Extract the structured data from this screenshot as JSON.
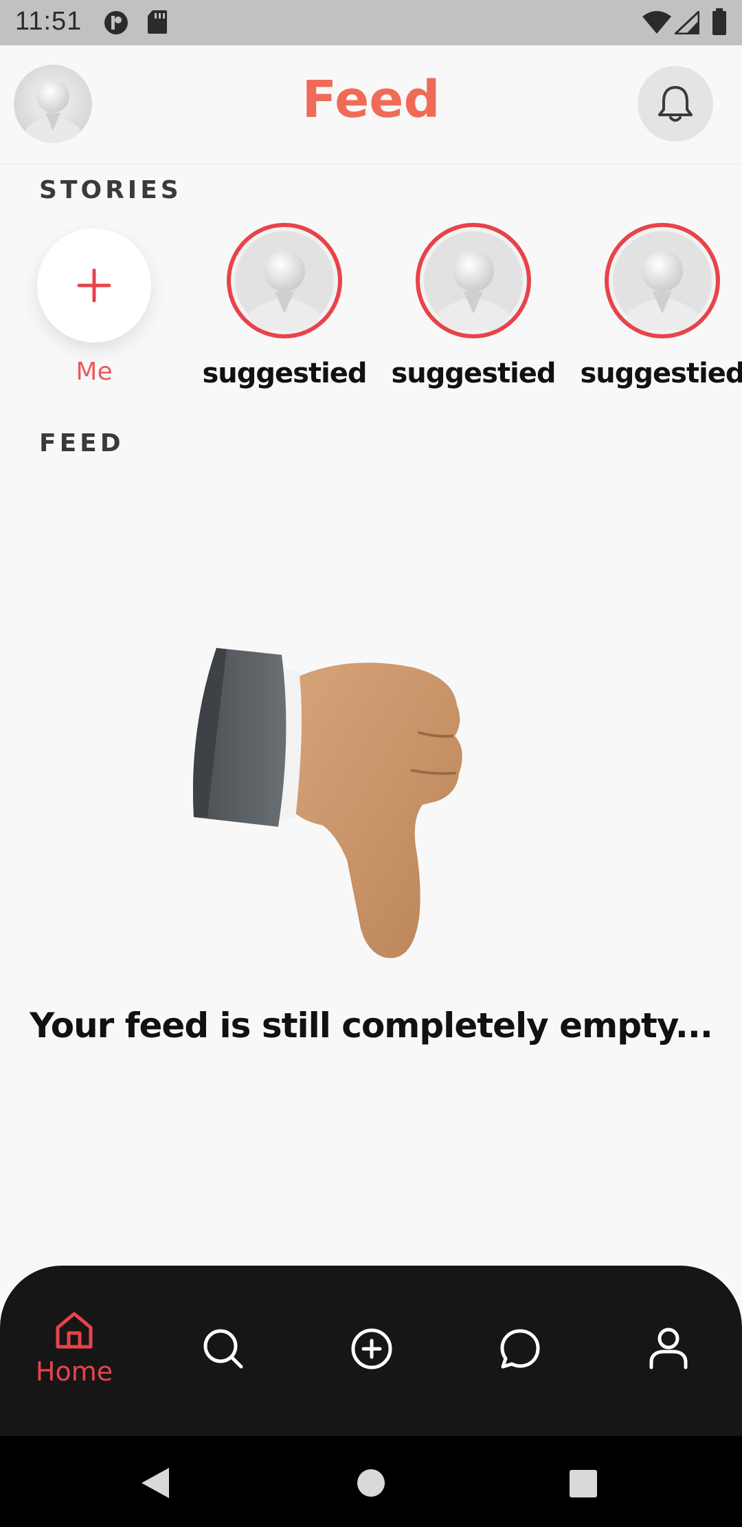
{
  "status_bar": {
    "time": "11:51",
    "left_icons": [
      "p-notification-icon",
      "sd-card-icon"
    ],
    "right_icons": [
      "wifi-icon",
      "cell-signal-icon",
      "battery-icon"
    ]
  },
  "header": {
    "title": "Feed",
    "title_color": "#ef6b57",
    "avatar_icon": "avatar-figure",
    "notification_icon": "bell-icon"
  },
  "stories": {
    "section_label": "STORIES",
    "add_story": {
      "label": "Me",
      "icon": "plus-icon"
    },
    "items": [
      {
        "label": "suggestied"
      },
      {
        "label": "suggestied"
      },
      {
        "label": "suggestied"
      }
    ],
    "ring_color": "#e8434a"
  },
  "feed": {
    "section_label": "FEED",
    "empty_illustration": "thumbs-down-hand",
    "empty_message": "Your feed is still completely empty..."
  },
  "bottom_nav": {
    "items": [
      {
        "id": "home",
        "label": "Home",
        "icon": "home-icon",
        "active": true
      },
      {
        "id": "search",
        "label": "",
        "icon": "search-icon",
        "active": false
      },
      {
        "id": "add",
        "label": "",
        "icon": "add-circle-icon",
        "active": false
      },
      {
        "id": "messages",
        "label": "",
        "icon": "chat-bubble-icon",
        "active": false
      },
      {
        "id": "profile",
        "label": "",
        "icon": "user-icon",
        "active": false
      }
    ],
    "active_color": "#e8434a",
    "background": "#161616"
  },
  "system_nav": [
    "back-icon",
    "home-circle-icon",
    "recents-icon"
  ]
}
